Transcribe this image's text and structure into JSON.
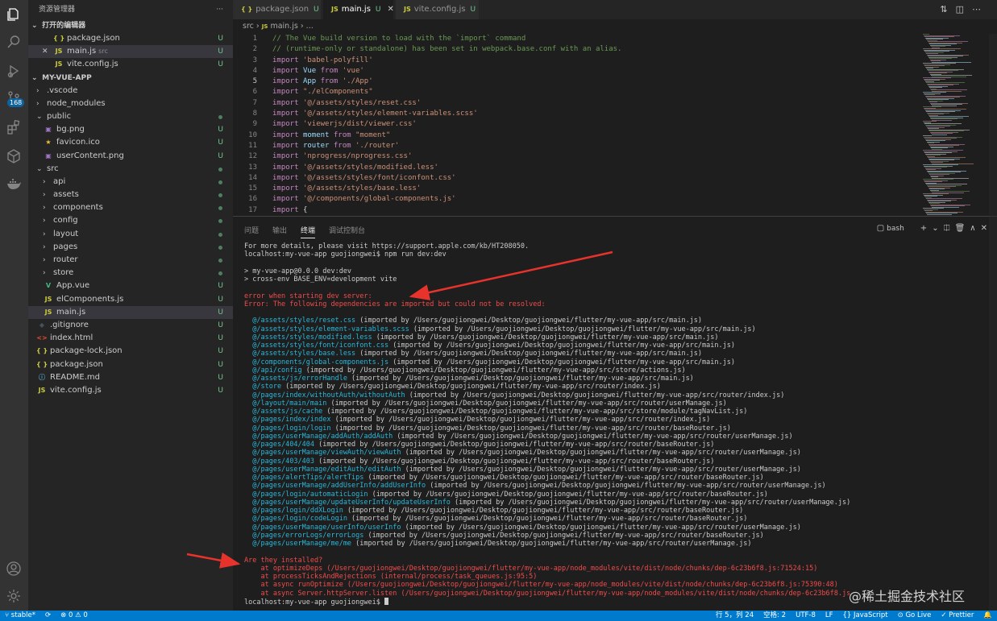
{
  "activity_bar": {
    "items": [
      {
        "name": "explorer-icon",
        "active": true
      },
      {
        "name": "search-icon"
      },
      {
        "name": "run-debug-icon"
      },
      {
        "name": "source-control-icon"
      },
      {
        "name": "extensions-icon"
      },
      {
        "name": "package-icon"
      },
      {
        "name": "docker-icon"
      }
    ],
    "badge": "168",
    "bottom": [
      {
        "name": "account-icon"
      },
      {
        "name": "settings-gear-icon"
      }
    ]
  },
  "sidebar": {
    "title": "资源管理器",
    "more": "···",
    "open_editors_header": "打开的编辑器",
    "open_editors": [
      {
        "name": "package.json",
        "icon": "{ }",
        "status": "U"
      },
      {
        "name": "main.js",
        "dir": "src",
        "icon": "JS",
        "status": "U",
        "close": "✕"
      },
      {
        "name": "vite.config.js",
        "icon": "JS",
        "status": "U"
      }
    ],
    "project_header": "MY-VUE-APP",
    "tree": [
      {
        "name": ".vscode",
        "depth": 0,
        "folder": true,
        "open": false
      },
      {
        "name": "node_modules",
        "depth": 0,
        "folder": true,
        "open": false
      },
      {
        "name": "public",
        "depth": 0,
        "folder": true,
        "open": true,
        "dot": true
      },
      {
        "name": "bg.png",
        "depth": 1,
        "icon": "▣",
        "kind": "img",
        "status": "U"
      },
      {
        "name": "favicon.ico",
        "depth": 1,
        "icon": "★",
        "kind": "star",
        "status": "U"
      },
      {
        "name": "userContent.png",
        "depth": 1,
        "icon": "▣",
        "kind": "img",
        "status": "U"
      },
      {
        "name": "src",
        "depth": 0,
        "folder": true,
        "open": true,
        "dot": true
      },
      {
        "name": "api",
        "depth": 1,
        "folder": true,
        "open": false,
        "dot": true
      },
      {
        "name": "assets",
        "depth": 1,
        "folder": true,
        "open": false,
        "dot": true
      },
      {
        "name": "components",
        "depth": 1,
        "folder": true,
        "open": false,
        "dot": true
      },
      {
        "name": "config",
        "depth": 1,
        "folder": true,
        "open": false,
        "dot": true
      },
      {
        "name": "layout",
        "depth": 1,
        "folder": true,
        "open": false,
        "dot": true
      },
      {
        "name": "pages",
        "depth": 1,
        "folder": true,
        "open": false,
        "dot": true
      },
      {
        "name": "router",
        "depth": 1,
        "folder": true,
        "open": false,
        "dot": true
      },
      {
        "name": "store",
        "depth": 1,
        "folder": true,
        "open": false,
        "dot": true
      },
      {
        "name": "App.vue",
        "depth": 1,
        "icon": "V",
        "kind": "vue",
        "status": "U"
      },
      {
        "name": "elComponents.js",
        "depth": 1,
        "icon": "JS",
        "kind": "js",
        "status": "U"
      },
      {
        "name": "main.js",
        "depth": 1,
        "icon": "JS",
        "kind": "js",
        "status": "U",
        "selected": true
      },
      {
        "name": ".gitignore",
        "depth": 0,
        "icon": "◆",
        "kind": "git",
        "status": "U"
      },
      {
        "name": "index.html",
        "depth": 0,
        "icon": "<>",
        "kind": "html",
        "status": "U"
      },
      {
        "name": "package-lock.json",
        "depth": 0,
        "icon": "{ }",
        "kind": "json",
        "status": "U"
      },
      {
        "name": "package.json",
        "depth": 0,
        "icon": "{ }",
        "kind": "json",
        "status": "U"
      },
      {
        "name": "README.md",
        "depth": 0,
        "icon": "ⓘ",
        "kind": "info",
        "status": "U"
      },
      {
        "name": "vite.config.js",
        "depth": 0,
        "icon": "JS",
        "kind": "js",
        "status": "U"
      }
    ]
  },
  "tabs": [
    {
      "label": "package.json",
      "icon": "{ }",
      "status": "U"
    },
    {
      "label": "main.js",
      "icon": "JS",
      "status": "U",
      "active": true,
      "close": "✕"
    },
    {
      "label": "vite.config.js",
      "icon": "JS",
      "status": "U"
    }
  ],
  "tab_actions": [
    "compare-icon",
    "split-editor-icon",
    "more-icon"
  ],
  "breadcrumb": {
    "folder": "src",
    "sep": "›",
    "file": "main.js",
    "tail": "..."
  },
  "editor": {
    "current_line": 5,
    "lines": [
      [
        [
          "cm",
          "// The Vue build version to load with the `import` command"
        ]
      ],
      [
        [
          "cm",
          "// (runtime-only or standalone) has been set in webpack.base.conf with an alias."
        ]
      ],
      [
        [
          "kw",
          "import "
        ],
        [
          "str",
          "'babel-polyfill'"
        ]
      ],
      [
        [
          "kw",
          "import "
        ],
        [
          "id",
          "Vue"
        ],
        [
          "kw",
          " from "
        ],
        [
          "str",
          "'vue'"
        ]
      ],
      [
        [
          "kw",
          "import "
        ],
        [
          "id",
          "App"
        ],
        [
          "kw",
          " from "
        ],
        [
          "str",
          "'./App'"
        ]
      ],
      [
        [
          "kw",
          "import "
        ],
        [
          "str",
          "\"./elComponents\""
        ]
      ],
      [
        [
          "kw",
          "import "
        ],
        [
          "str",
          "'@/assets/styles/reset.css'"
        ]
      ],
      [
        [
          "kw",
          "import "
        ],
        [
          "str",
          "'@/assets/styles/element-variables.scss'"
        ]
      ],
      [
        [
          "kw",
          "import "
        ],
        [
          "str",
          "'viewerjs/dist/viewer.css'"
        ]
      ],
      [
        [
          "kw",
          "import "
        ],
        [
          "id",
          "moment"
        ],
        [
          "kw",
          " from "
        ],
        [
          "str",
          "\"moment\""
        ]
      ],
      [
        [
          "kw",
          "import "
        ],
        [
          "id",
          "router"
        ],
        [
          "kw",
          " from "
        ],
        [
          "str",
          "'./router'"
        ]
      ],
      [
        [
          "kw",
          "import "
        ],
        [
          "str",
          "'nprogress/nprogress.css'"
        ]
      ],
      [
        [
          "kw",
          "import "
        ],
        [
          "str",
          "'@/assets/styles/modified.less'"
        ]
      ],
      [
        [
          "kw",
          "import "
        ],
        [
          "str",
          "'@/assets/styles/font/iconfont.css'"
        ]
      ],
      [
        [
          "kw",
          "import "
        ],
        [
          "str",
          "'@/assets/styles/base.less'"
        ]
      ],
      [
        [
          "kw",
          "import "
        ],
        [
          "str",
          "'@/components/global-components.js'"
        ]
      ],
      [
        [
          "kw",
          "import "
        ],
        [
          "pn",
          "{"
        ]
      ],
      [
        [
          "pn",
          "  ..."
        ]
      ]
    ]
  },
  "panel": {
    "tabs": [
      "问题",
      "输出",
      "终端",
      "调试控制台"
    ],
    "active_tab": 2,
    "terminal_name": "bash",
    "actions": [
      "+",
      "⌄",
      "⎅",
      "🗑",
      "∧",
      "✕"
    ]
  },
  "terminal": {
    "lines": [
      [
        [
          "t-grey",
          "For more details, please visit https://support.apple.com/kb/HT208050."
        ]
      ],
      [
        [
          "t-grey",
          "localhost:my-vue-app guojiongwei$ npm run dev:dev"
        ]
      ],
      [
        [
          "t-grey",
          ""
        ]
      ],
      [
        [
          "t-grey",
          "> my-vue-app@0.0.0 dev:dev"
        ]
      ],
      [
        [
          "t-grey",
          "> cross-env BASE_ENV=development vite"
        ]
      ],
      [
        [
          "t-grey",
          ""
        ]
      ],
      [
        [
          "t-red",
          "error when starting dev server:"
        ]
      ],
      [
        [
          "t-red",
          "Error: The following dependencies are imported but could not be resolved:"
        ]
      ],
      [
        [
          "t-grey",
          ""
        ]
      ],
      [
        [
          "t-cyan",
          "  @/assets/styles/reset.css"
        ],
        [
          "t-grey",
          " (imported by /Users/guojiongwei/Desktop/guojiongwei/flutter/my-vue-app/src/main.js)"
        ]
      ],
      [
        [
          "t-cyan",
          "  @/assets/styles/element-variables.scss"
        ],
        [
          "t-grey",
          " (imported by /Users/guojiongwei/Desktop/guojiongwei/flutter/my-vue-app/src/main.js)"
        ]
      ],
      [
        [
          "t-cyan",
          "  @/assets/styles/modified.less"
        ],
        [
          "t-grey",
          " (imported by /Users/guojiongwei/Desktop/guojiongwei/flutter/my-vue-app/src/main.js)"
        ]
      ],
      [
        [
          "t-cyan",
          "  @/assets/styles/font/iconfont.css"
        ],
        [
          "t-grey",
          " (imported by /Users/guojiongwei/Desktop/guojiongwei/flutter/my-vue-app/src/main.js)"
        ]
      ],
      [
        [
          "t-cyan",
          "  @/assets/styles/base.less"
        ],
        [
          "t-grey",
          " (imported by /Users/guojiongwei/Desktop/guojiongwei/flutter/my-vue-app/src/main.js)"
        ]
      ],
      [
        [
          "t-cyan",
          "  @/components/global-components.js"
        ],
        [
          "t-grey",
          " (imported by /Users/guojiongwei/Desktop/guojiongwei/flutter/my-vue-app/src/main.js)"
        ]
      ],
      [
        [
          "t-cyan",
          "  @/api/config"
        ],
        [
          "t-grey",
          " (imported by /Users/guojiongwei/Desktop/guojiongwei/flutter/my-vue-app/src/store/actions.js)"
        ]
      ],
      [
        [
          "t-cyan",
          "  @/assets/js/errorHandle"
        ],
        [
          "t-grey",
          " (imported by /Users/guojiongwei/Desktop/guojiongwei/flutter/my-vue-app/src/main.js)"
        ]
      ],
      [
        [
          "t-cyan",
          "  @/store"
        ],
        [
          "t-grey",
          " (imported by /Users/guojiongwei/Desktop/guojiongwei/flutter/my-vue-app/src/router/index.js)"
        ]
      ],
      [
        [
          "t-cyan",
          "  @/pages/index/withoutAuth/withoutAuth"
        ],
        [
          "t-grey",
          " (imported by /Users/guojiongwei/Desktop/guojiongwei/flutter/my-vue-app/src/router/index.js)"
        ]
      ],
      [
        [
          "t-cyan",
          "  @/layout/main/main"
        ],
        [
          "t-grey",
          " (imported by /Users/guojiongwei/Desktop/guojiongwei/flutter/my-vue-app/src/router/userManage.js)"
        ]
      ],
      [
        [
          "t-cyan",
          "  @/assets/js/cache"
        ],
        [
          "t-grey",
          " (imported by /Users/guojiongwei/Desktop/guojiongwei/flutter/my-vue-app/src/store/module/tagNavList.js)"
        ]
      ],
      [
        [
          "t-cyan",
          "  @/pages/index/index"
        ],
        [
          "t-grey",
          " (imported by /Users/guojiongwei/Desktop/guojiongwei/flutter/my-vue-app/src/router/index.js)"
        ]
      ],
      [
        [
          "t-cyan",
          "  @/pages/login/login"
        ],
        [
          "t-grey",
          " (imported by /Users/guojiongwei/Desktop/guojiongwei/flutter/my-vue-app/src/router/baseRouter.js)"
        ]
      ],
      [
        [
          "t-cyan",
          "  @/pages/userManage/addAuth/addAuth"
        ],
        [
          "t-grey",
          " (imported by /Users/guojiongwei/Desktop/guojiongwei/flutter/my-vue-app/src/router/userManage.js)"
        ]
      ],
      [
        [
          "t-cyan",
          "  @/pages/404/404"
        ],
        [
          "t-grey",
          " (imported by /Users/guojiongwei/Desktop/guojiongwei/flutter/my-vue-app/src/router/baseRouter.js)"
        ]
      ],
      [
        [
          "t-cyan",
          "  @/pages/userManage/viewAuth/viewAuth"
        ],
        [
          "t-grey",
          " (imported by /Users/guojiongwei/Desktop/guojiongwei/flutter/my-vue-app/src/router/userManage.js)"
        ]
      ],
      [
        [
          "t-cyan",
          "  @/pages/403/403"
        ],
        [
          "t-grey",
          " (imported by /Users/guojiongwei/Desktop/guojiongwei/flutter/my-vue-app/src/router/baseRouter.js)"
        ]
      ],
      [
        [
          "t-cyan",
          "  @/pages/userManage/editAuth/editAuth"
        ],
        [
          "t-grey",
          " (imported by /Users/guojiongwei/Desktop/guojiongwei/flutter/my-vue-app/src/router/userManage.js)"
        ]
      ],
      [
        [
          "t-cyan",
          "  @/pages/alertTips/alertTips"
        ],
        [
          "t-grey",
          " (imported by /Users/guojiongwei/Desktop/guojiongwei/flutter/my-vue-app/src/router/baseRouter.js)"
        ]
      ],
      [
        [
          "t-cyan",
          "  @/pages/userManage/addUserInfo/addUserInfo"
        ],
        [
          "t-grey",
          " (imported by /Users/guojiongwei/Desktop/guojiongwei/flutter/my-vue-app/src/router/userManage.js)"
        ]
      ],
      [
        [
          "t-cyan",
          "  @/pages/login/automaticLogin"
        ],
        [
          "t-grey",
          " (imported by /Users/guojiongwei/Desktop/guojiongwei/flutter/my-vue-app/src/router/baseRouter.js)"
        ]
      ],
      [
        [
          "t-cyan",
          "  @/pages/userManage/updateUserInfo/updateUserInfo"
        ],
        [
          "t-grey",
          " (imported by /Users/guojiongwei/Desktop/guojiongwei/flutter/my-vue-app/src/router/userManage.js)"
        ]
      ],
      [
        [
          "t-cyan",
          "  @/pages/login/ddXLogin"
        ],
        [
          "t-grey",
          " (imported by /Users/guojiongwei/Desktop/guojiongwei/flutter/my-vue-app/src/router/baseRouter.js)"
        ]
      ],
      [
        [
          "t-cyan",
          "  @/pages/login/codeLogin"
        ],
        [
          "t-grey",
          " (imported by /Users/guojiongwei/Desktop/guojiongwei/flutter/my-vue-app/src/router/baseRouter.js)"
        ]
      ],
      [
        [
          "t-cyan",
          "  @/pages/userManage/userInfo/userInfo"
        ],
        [
          "t-grey",
          " (imported by /Users/guojiongwei/Desktop/guojiongwei/flutter/my-vue-app/src/router/userManage.js)"
        ]
      ],
      [
        [
          "t-cyan",
          "  @/pages/errorLogs/errorLogs"
        ],
        [
          "t-grey",
          " (imported by /Users/guojiongwei/Desktop/guojiongwei/flutter/my-vue-app/src/router/baseRouter.js)"
        ]
      ],
      [
        [
          "t-cyan",
          "  @/pages/userManage/me/me"
        ],
        [
          "t-grey",
          " (imported by /Users/guojiongwei/Desktop/guojiongwei/flutter/my-vue-app/src/router/userManage.js)"
        ]
      ],
      [
        [
          "t-grey",
          ""
        ]
      ],
      [
        [
          "t-red",
          "Are they installed?"
        ]
      ],
      [
        [
          "t-red",
          "    at optimizeDeps (/Users/guojiongwei/Desktop/guojiongwei/flutter/my-vue-app/node_modules/vite/dist/node/chunks/dep-6c23b6f8.js:71524:15)"
        ]
      ],
      [
        [
          "t-red",
          "    at processTicksAndRejections (internal/process/task_queues.js:95:5)"
        ]
      ],
      [
        [
          "t-red",
          "    at async runOptimize (/Users/guojiongwei/Desktop/guojiongwei/flutter/my-vue-app/node_modules/vite/dist/node/chunks/dep-6c23b6f8.js:75390:48)"
        ]
      ],
      [
        [
          "t-red",
          "    at async Server.httpServer.listen (/Users/guojiongwei/Desktop/guojiongwei/flutter/my-vue-app/node_modules/vite/dist/node/chunks/dep-6c23b6f8.js"
        ]
      ],
      [
        [
          "t-grey",
          "localhost:my-vue-app guojiongwei$ "
        ]
      ]
    ]
  },
  "watermark": "@稀土掘金技术社区",
  "status_bar": {
    "left": [
      "⑂ stable*",
      "⟳",
      "⊗ 0 ⚠ 0"
    ],
    "right": [
      "行 5，列 24",
      "空格: 2",
      "UTF-8",
      "LF",
      "{} JavaScript",
      "⊙ Go Live",
      "✓ Prettier",
      "🔔"
    ]
  },
  "colors": {
    "accent": "#007acc",
    "error": "#f14c4c",
    "link": "#29b8db",
    "untracked": "#73c991",
    "arrow": "#e8332c"
  }
}
